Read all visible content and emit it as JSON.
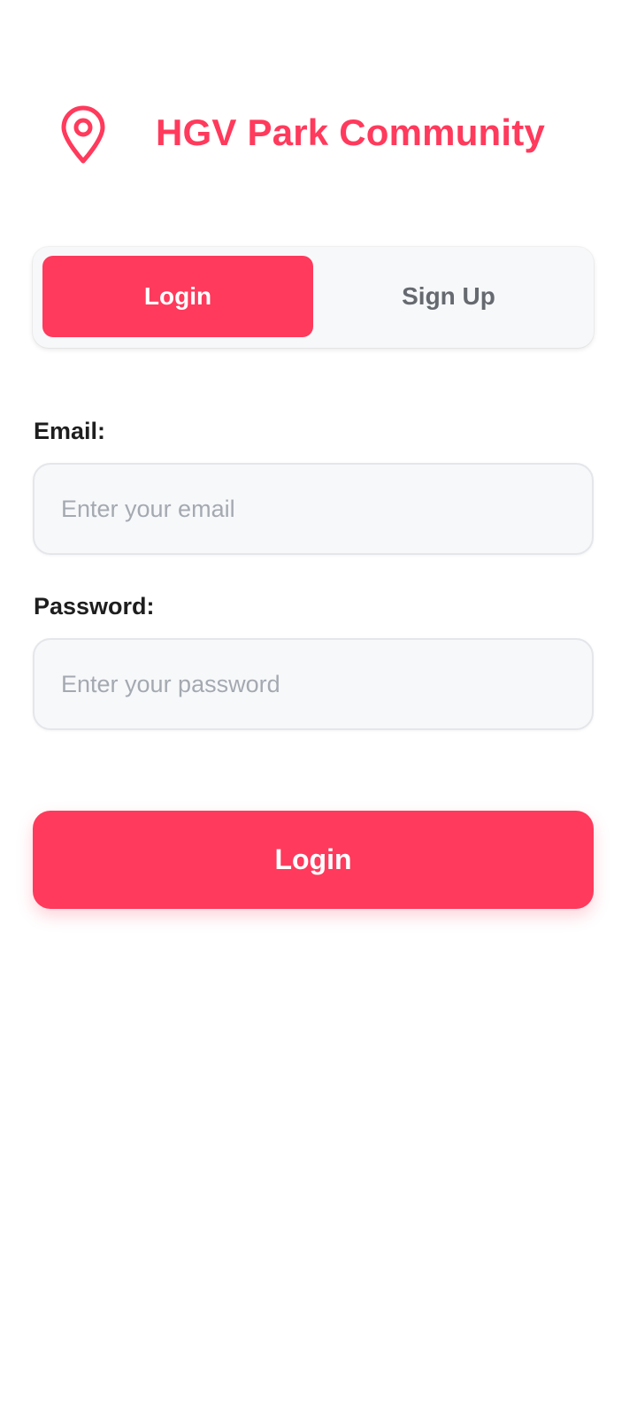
{
  "header": {
    "icon": "location-pin-icon",
    "title": "HGV Park Community"
  },
  "tabs": [
    {
      "label": "Login",
      "active": true
    },
    {
      "label": "Sign Up",
      "active": false
    }
  ],
  "form": {
    "email": {
      "label": "Email:",
      "value": "",
      "placeholder": "Enter your email"
    },
    "password": {
      "label": "Password:",
      "value": "",
      "placeholder": "Enter your password"
    },
    "submit_label": "Login"
  },
  "colors": {
    "accent": "#ff3a5c",
    "tab_background": "#f7f8fa",
    "inactive_text": "#666a70",
    "placeholder": "#a4a9b1"
  }
}
